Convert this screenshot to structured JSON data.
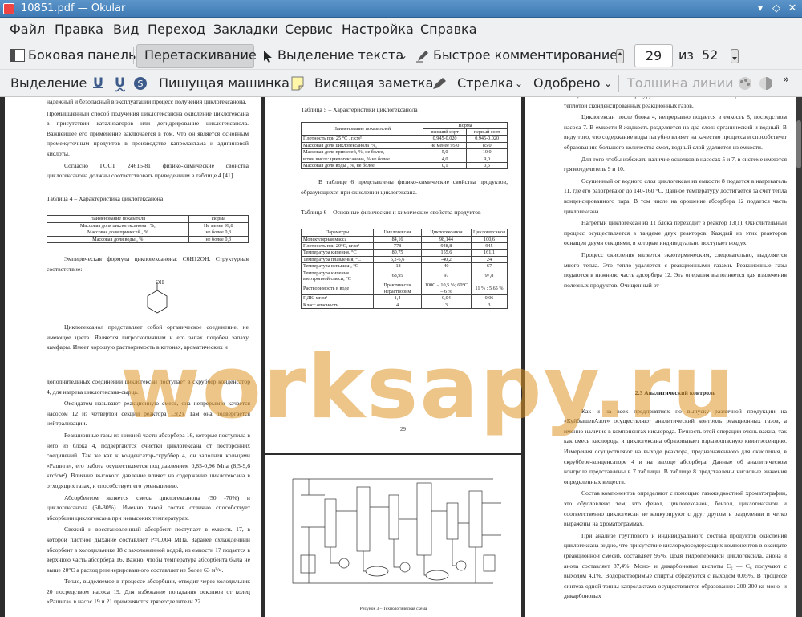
{
  "window": {
    "title": "10851.pdf  — Okular"
  },
  "menu": [
    "Файл",
    "Правка",
    "Вид",
    "Переход",
    "Закладки",
    "Сервис",
    "Настройка",
    "Справка"
  ],
  "toolbar1": {
    "sidebar": "Боковая панель",
    "drag": "Перетаскивание",
    "text_select": "Выделение текста",
    "quick_comment": "Быстрое комментирование",
    "page_current": "29",
    "page_of": "из",
    "page_total": "52"
  },
  "toolbar2": {
    "highlight": "Выделение",
    "u1": "U",
    "u2": "U",
    "typewriter": "Пишущая машинка",
    "sticky": "Висящая заметка",
    "arrow": "Стрелка",
    "approved": "Одобрено",
    "line_width": "Толщина линии"
  },
  "watermark": "worksapy.ru",
  "page28": {
    "top": "надежный и безопасный в эксплуатации процесс получения циклогексанона.",
    "p1": "Промышленный способ получения циклогексанона окисление циклогексана в присутствии катализаторов или дегидрирование циклогексанола. Важнейшее его применение заключается в том. Что он является основным промежуточным продуктов в производстве капролактама и адипиновой кислоты.",
    "p2": "Согласно ГОСТ 24615-81 физико-химические свойства циклогексанона должны соответствовать приведенным в таблице 4 [41].",
    "caption": "Таблица 4 – Характеристика циклогексанона",
    "th1": "Наименование показателя",
    "th2": "Норма",
    "rows": [
      [
        "Массовая доля циклогексанона , %,",
        "Не менее 99,8"
      ],
      [
        "Массовая доля примесей , %",
        "не более 0,3"
      ],
      [
        "Массовая доля воды , %",
        "не более 0,3"
      ]
    ],
    "formula": "Эмпирическая формула циклогексанона: C6H12OH. Структурная соответствие:",
    "oh": "OH",
    "p3": "Циклогексанол представляет собой органическое соединение, не имеющее цвета. Является гигроскопичным и его запах подобен запаху камфары. Имеет хорошую растворимость в кетонах, ароматических и",
    "num": "28"
  },
  "page29": {
    "cap5": "Таблица 5 – Характеристики циклогексанола",
    "t5h": [
      "Наименование показателей",
      "Норма",
      "высший сорт",
      "первый сорт"
    ],
    "t5": [
      [
        "Плотность при 25 °С , г/см³",
        "0,945-0,020",
        "0,945-0,020"
      ],
      [
        "Массовая доля циклогексанола ,%,",
        "не менее 95,0",
        "85,0"
      ],
      [
        "Массовая доля примесей, %, не более,",
        "5,0",
        "10,0"
      ],
      [
        "в том числе: циклогексанона, % не более",
        "4,0",
        "9,0"
      ],
      [
        "Массовая доля воды , %, не более",
        "0,1",
        "0,5"
      ]
    ],
    "p1": "В таблице 6 представлены физико-химические свойства продуктов, образующихся при окислении циклогексана.",
    "cap6": "Таблица 6 – Основные физические и химические свойства продуктов",
    "t6h": [
      "Параметры",
      "Циклогексан",
      "Циклогексанон",
      "Циклогексанол"
    ],
    "t6": [
      [
        "Молекулярная масса",
        "84,16",
        "98,144",
        "100,6"
      ],
      [
        "Плотность при 20°С, кг/м³",
        "778",
        "948,8",
        "945"
      ],
      [
        "Температура кипения, °С",
        "80,75",
        "155,6",
        "161,1"
      ],
      [
        "Температура плавления, °С",
        "6,2-6,6",
        "-40,2",
        "24"
      ],
      [
        "Температура вспышки, °С",
        "-18",
        "40",
        "67"
      ],
      [
        "Температура кипения азеотропной смеси, °С",
        "68,95",
        "97",
        "97,8"
      ],
      [
        "Растворимость в воде",
        "Практически нерастворим",
        "100С – 10,5 %; 60°С – 6 %",
        "11 % ; 5,65 %"
      ],
      [
        "ПДК, мг/м³",
        "1,4",
        "0,04",
        "0,06"
      ],
      [
        "Класс опасности",
        "4",
        "3",
        "3"
      ]
    ],
    "num": "29"
  },
  "page30": {
    "top": "кольца «Рашига» и температуру составляет 135°С. Также нагрев обеспечивается теплотой сконденсированных реакционных газов.",
    "p1": "Циклогексан после блока 4, непрерывно подается в емкость 8, посредством насоса 7. В емкости 8 жидкость разделяется на два слоя: органический и водный. В виду того, что содержание воды пагубно влияет на качество процесса и способствует образованию большого количества смол, водный слой удаляется из емкости.",
    "p2": "Для того чтобы избежать наличие осколков в насосах 5 и 7, в системе имеются грязеотделитель 9 и 10.",
    "p3": "Осушенный от водного слоя циклогексан из емкости 8 подается в нагреватель 11, где его разогревают до 140-160 °С. Данное температуру достигается за счет тепла конденсированного пара. В том числе на орошение абсорбера 12 подается часть циклогексана.",
    "p4": "Нагретый циклогексан из 11 блока переходит в реактор 13(1). Окислительный процесс осуществляется в тандеме двух реакторов. Каждый из этих реакторов оснащен двумя секциями, в которые индивидуально поступает воздух.",
    "p5": "Процесс окисления является экзотермическим, следовательно, выделяется много тепла. Это тепло удаляется с реакционными газами. Реакционные газы подаются в нижнюю часть адсорбера 12. Эта операция выполняется для извлечения полезных продуктов. Очищенный от"
  },
  "page31": {
    "p0": "дополнительных соединений циклогексан поступает в скруббер конденсатор 4, для нагрева циклогексана-сырца.",
    "p1": "Оксидатом называют реакционную смесь, она непрерывно качается насосом 12 из четвертой секции реактора 13(2). Там она подвергается нейтрализации.",
    "p2": "Реакционные газы из нижней части абсорбера 16, которые поступила в него из блока 4, подвергаются очистки циклогексана от посторонних соединений. Так же как к конденсатор-скруббер 4, он заполнен кольцами «Рашига», его работа осуществляется под давлением 0,85-0,96 Мпа (8,5-9,6 кгс/см²). Влияние высокого давление влияет на содержание циклогексана в отходящих газах, и способствует его уменьшению.",
    "p3": "Абсорбентом является смесь циклогексанона (50 -70%) и циклогексанола (50-30%). Именно такой состав отлично способствует абсорбции циклогексана при невысоких температурах.",
    "p4": "Свежий и восстановленный абсорбент поступает в емкость 17, в которой плотное дыхание составляет Р=0,004 МПа. Заранее охлажденный абсорбент в холодильнике 18 с захоложенной водой, из емкости 17 подается в верхнюю часть абсорбера 16. Важно, чтобы температура абсорбента была не выше 20°С а расход регенерированного составляет не более 63 м³/ч.",
    "p5": "Тепло, выделяемое в процессе абсорбции, отводит через холодильник 20 посредством насоса 19. Для избежание попадания осколков от колец «Рашига» в насос 19 и 21 применяются грязеотделители 22."
  },
  "page32": {
    "caption": "Рисунок 3 – Технологическая схема"
  },
  "page33": {
    "heading": "2.3 Аналитический контроль",
    "p1": "Как и на всех предприятиях по выпуску различной продукции на «КуйбышевАзот» осуществляют аналитический контроль реакционных газов, а именно наличие в компонентах кислорода. Точность этой операции очень важна, так как смесь кислорода и циклогексана образовывает взрывоопасную квинтэссенцию. Измерения осуществляют на выходе реактора, предназначенного для окисления, в скруббере-конденсаторе 4 и на выходе абсорбера. Данные об аналитическом контроле представлены в 7 таблицы. В таблице 8 представлены числовые значения определенных веществ.",
    "p2": "Состав компонентов определяют с помощью газожидкостной хроматографии, это обусловлено тем, что фенол, циклогексанон, бензол, циклогексанон и соответственно циклогексан не конкурируют с друг другом в разделении и четко выражены на хроматограммах.",
    "p3": "При анализе группового и индивидуального состава продуктов окисления циклогексана видно, что присутствие кислородосодержащих компонентов в оксидате (реакционной смеси), составляет 95%. Доля гидроперекиси циклогексила, анона и анола составляет 87,4%. Моно- и дикарбоновые кислоты C₂ — C₆ получают с выходом 4,1%. Водорастворимые спирты образуются с выходом 0,05%. В процессе синтеза одной тонны капролактама осуществляется образование: 200-300 кг моно- и дикарбоновых"
  }
}
